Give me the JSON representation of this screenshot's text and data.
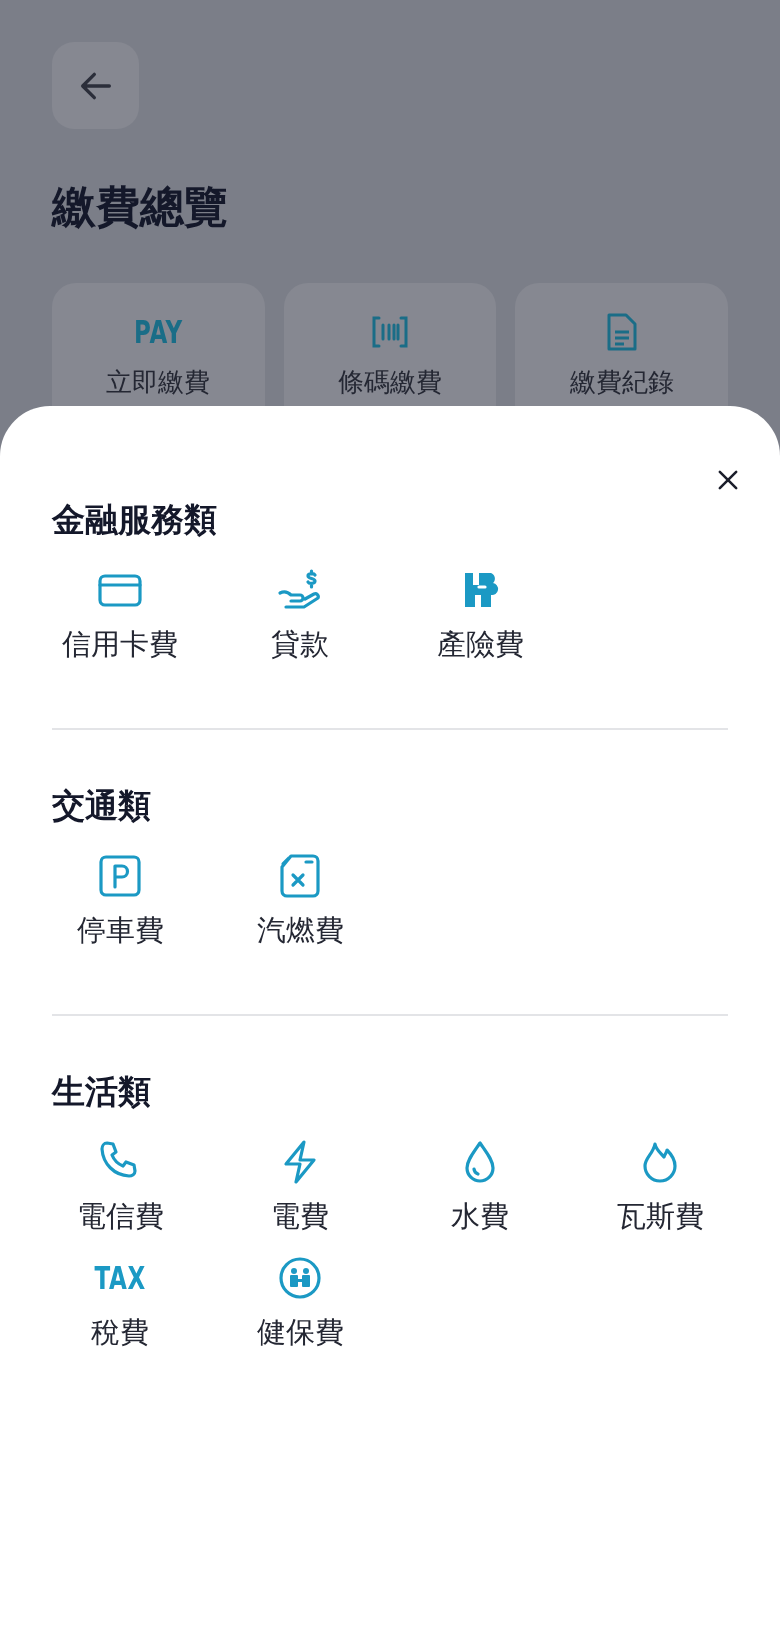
{
  "page": {
    "title": "繳費總覽",
    "quick_actions": [
      {
        "kind": "text",
        "icon_text": "PAY",
        "label": "立即繳費"
      },
      {
        "kind": "barcode",
        "label": "條碼繳費"
      },
      {
        "kind": "document",
        "label": "繳費紀錄"
      }
    ]
  },
  "sheet": {
    "sections": [
      {
        "title": "金融服務類",
        "items": [
          {
            "kind": "card",
            "label": "信用卡費"
          },
          {
            "kind": "loan",
            "label": "貸款"
          },
          {
            "kind": "insurance",
            "label": "產險費"
          }
        ]
      },
      {
        "title": "交通類",
        "items": [
          {
            "kind": "parking",
            "label": "停車費"
          },
          {
            "kind": "fuel",
            "label": "汽燃費"
          }
        ]
      },
      {
        "title": "生活類",
        "items": [
          {
            "kind": "phone",
            "label": "電信費"
          },
          {
            "kind": "bolt",
            "label": "電費"
          },
          {
            "kind": "water",
            "label": "水費"
          },
          {
            "kind": "fire",
            "label": "瓦斯費"
          },
          {
            "kind": "text",
            "icon_text": "TAX",
            "label": "稅費"
          },
          {
            "kind": "health",
            "label": "健保費"
          }
        ]
      }
    ]
  }
}
